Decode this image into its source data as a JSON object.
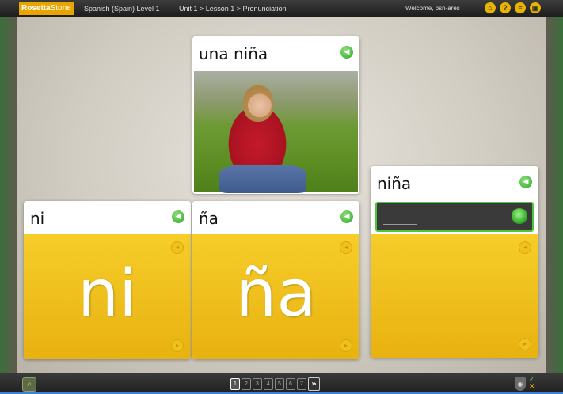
{
  "app": {
    "logo_bold": "Rosetta",
    "logo_rest": "Stone",
    "course": "Spanish (Spain) Level 1",
    "breadcrumb": "Unit 1 > Lesson 1 > Pronunciation",
    "welcome": "Welcome, bsn-ares",
    "toolbar_icons": [
      "home-icon",
      "help-icon",
      "menu-icon",
      "settings-icon"
    ]
  },
  "cards": {
    "image_card": {
      "title": "una niña",
      "photo": "girl-sitting-on-grass"
    },
    "syllable_1": {
      "title": "ni",
      "big": "ni"
    },
    "syllable_2": {
      "title": "ña",
      "big": "ña"
    },
    "answer_card": {
      "title": "niña",
      "input_value": ""
    }
  },
  "pager": {
    "pages": [
      "1",
      "2",
      "3",
      "4",
      "5",
      "6",
      "7"
    ],
    "current": "1",
    "next_label": "»"
  },
  "colors": {
    "accent_yellow": "#f2c11e",
    "mic_green": "#36b12b",
    "logo_orange": "#e8a500"
  }
}
